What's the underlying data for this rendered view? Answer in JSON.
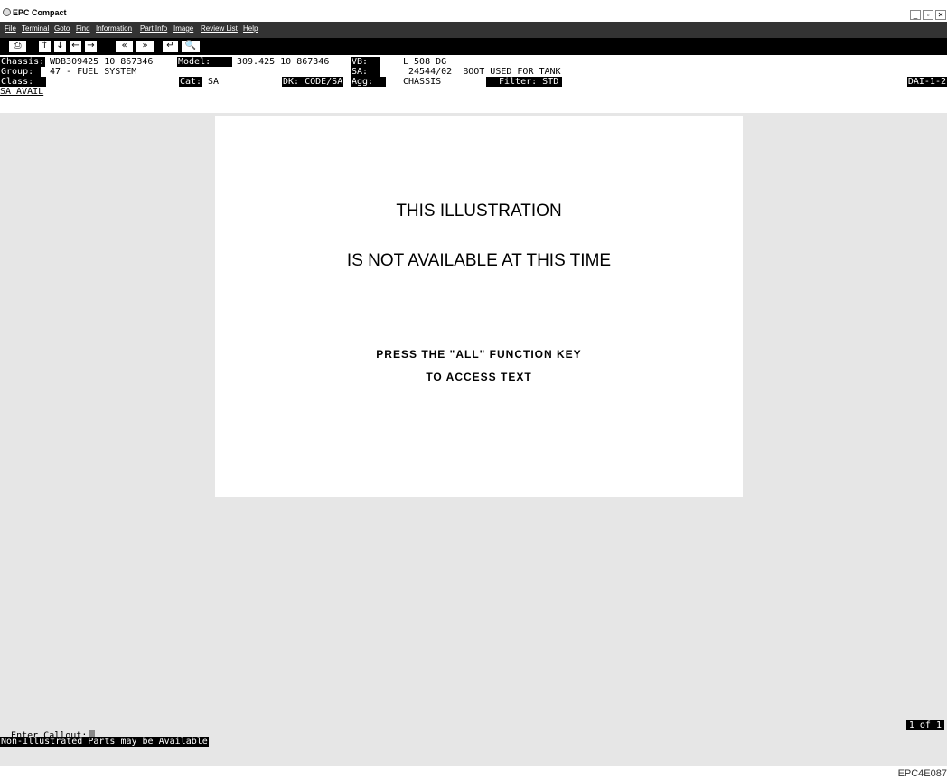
{
  "window": {
    "title": "EPC Compact",
    "controls": [
      "_",
      "▫",
      "✕"
    ]
  },
  "menu": [
    "File",
    "Terminal",
    "Goto",
    "Find",
    "Information",
    "Part Info",
    "Image",
    "Review List",
    "Help"
  ],
  "toolbar": [
    "⎙",
    "↑",
    "↓",
    "←",
    "→",
    "«",
    "»",
    "↵",
    "🔍"
  ],
  "header": {
    "chassis_label": "Chassis:",
    "chassis_value": "WDB309425 10 867346",
    "model_label": "Model:",
    "model_value": "309.425 10 867346",
    "vb_label": "VB:",
    "vb_value": "L 508 DG",
    "group_label": "Group:",
    "group_value": "47 - FUEL SYSTEM",
    "sa_label": "SA:",
    "sa_value": "24544/02  BOOT USED FOR TANK",
    "class_label": "Class:",
    "cat_label": "Cat:",
    "cat_value": "SA",
    "dk_label": "DK: CODE/SA",
    "agg_label": "Agg:",
    "agg_value": "CHASSIS",
    "filter_label": "Filter: STD",
    "dai_label": "DAI-1-2",
    "sa_avail": "SA AVAIL"
  },
  "illustration": {
    "line1": "THIS ILLUSTRATION",
    "line2": "IS NOT AVAILABLE AT THIS TIME",
    "line3": "PRESS THE \"ALL\" FUNCTION KEY",
    "line4": "TO ACCESS TEXT"
  },
  "footer": {
    "callout_label": "Enter Callout:",
    "non_illustrated": "Non-Illustrated Parts may be Available",
    "page_indicator": "1 of 1",
    "screen_code": "EPC4E087"
  }
}
